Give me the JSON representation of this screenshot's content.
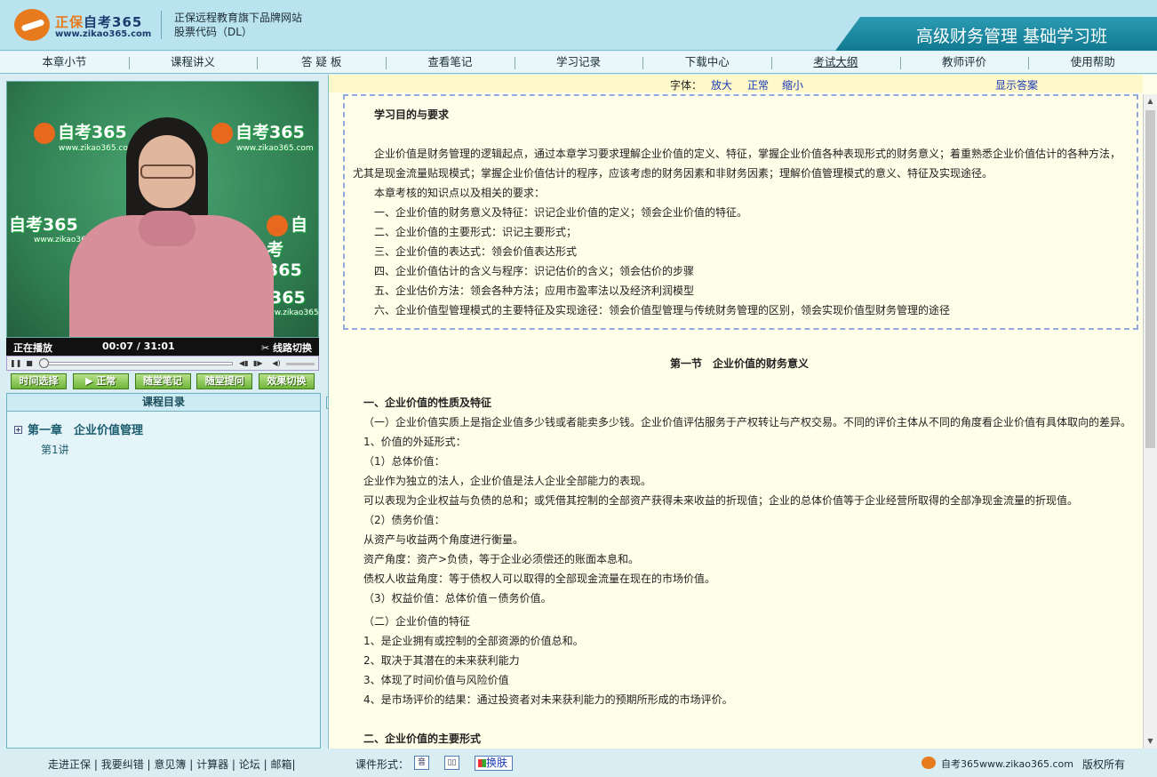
{
  "header": {
    "brand_cn": "正保",
    "brand_name": "自考365",
    "brand_url": "www.zikao365.com",
    "tagline_line1": "正保远程教育旗下品牌网站",
    "tagline_line2": "股票代码（DL）",
    "course_title": "高级财务管理 基础学习班"
  },
  "nav": {
    "items": [
      "本章小节",
      "课程讲义",
      "答 疑 板",
      "查看笔记",
      "学习记录",
      "下载中心",
      "考试大纲",
      "教师评价",
      "使用帮助"
    ]
  },
  "video": {
    "watermark": "自考365",
    "watermark_url": "www.zikao365.com",
    "status": "正在播放",
    "time": "00:07 / 31:01",
    "switch_label": "线路切换"
  },
  "controls": {
    "buttons": [
      "时间选择",
      "正常",
      "随堂笔记",
      "随堂提问",
      "效果切换"
    ]
  },
  "toc": {
    "title": "课程目录",
    "chapter": "第一章　企业价值管理",
    "lecture": "第1讲"
  },
  "fontbar": {
    "label": "字体：",
    "enlarge": "放大",
    "normal": "正常",
    "shrink": "缩小",
    "show_answer": "显示答案"
  },
  "lesson": {
    "goal_title": "学习目的与要求",
    "goal_p1a": "企业价值是财务管理的逻辑起点，通过本章学习要求理解企业价值的定义、特征，掌握企业价值各种表现形式的财务意义；着重熟悉企业价值估计的各种方法，",
    "goal_p1b": "尤其是现金流量贴现模式；掌握企业价值估计的程序，应该考虑的财务因素和非财务因素；理解价值管理模式的意义、特征及实现途径。",
    "goal_p2": "本章考核的知识点以及相关的要求：",
    "goal_items": [
      "一、企业价值的财务意义及特征：识记企业价值的定义；领会企业价值的特征。",
      "二、企业价值的主要形式：识记主要形式；",
      "三、企业价值的表达式：领会价值表达形式",
      "四、企业价值估计的含义与程序：识记估价的含义；领会估价的步骤",
      "五、企业估价方法：领会各种方法；应用市盈率法以及经济利润模型",
      "六、企业价值型管理模式的主要特征及实现途径：领会价值型管理与传统财务管理的区别，领会实现价值型财务管理的途径"
    ],
    "section_title": "第一节　企业价值的财务意义",
    "h1": "一、企业价值的性质及特征",
    "lines": [
      "（一）企业价值实质上是指企业值多少钱或者能卖多少钱。企业价值评估服务于产权转让与产权交易。不同的评价主体从不同的角度看企业价值有具体取向的差异。",
      "1、价值的外延形式：",
      "（1）总体价值：",
      "企业作为独立的法人，企业价值是法人企业全部能力的表现。",
      "可以表现为企业权益与负债的总和；或凭借其控制的全部资产获得未来收益的折现值；企业的总体价值等于企业经营所取得的全部净现金流量的折现值。",
      "（2）债务价值：",
      "从资产与收益两个角度进行衡量。",
      "资产角度：资产>负债，等于企业必须偿还的账面本息和。",
      "债权人收益角度：等于债权人可以取得的全部现金流量在现在的市场价值。",
      "（3）权益价值：总体价值－债务价值。",
      "（二）企业价值的特征",
      "1、是企业拥有或控制的全部资源的价值总和。",
      "2、取决于其潜在的未来获利能力",
      "3、体现了时间价值与风险价值",
      "4、是市场评价的结果：通过投资者对未来获利能力的预期所形成的市场评价。"
    ],
    "h2": "二、企业价值的主要形式"
  },
  "footer": {
    "links": [
      "走进正保",
      "我要纠错",
      "意见簿",
      "计算器",
      "论坛",
      "邮箱"
    ],
    "format_label": "课件形式：",
    "skin_label": "换肤",
    "site": "自考365www.zikao365.com",
    "copyright": "版权所有"
  }
}
